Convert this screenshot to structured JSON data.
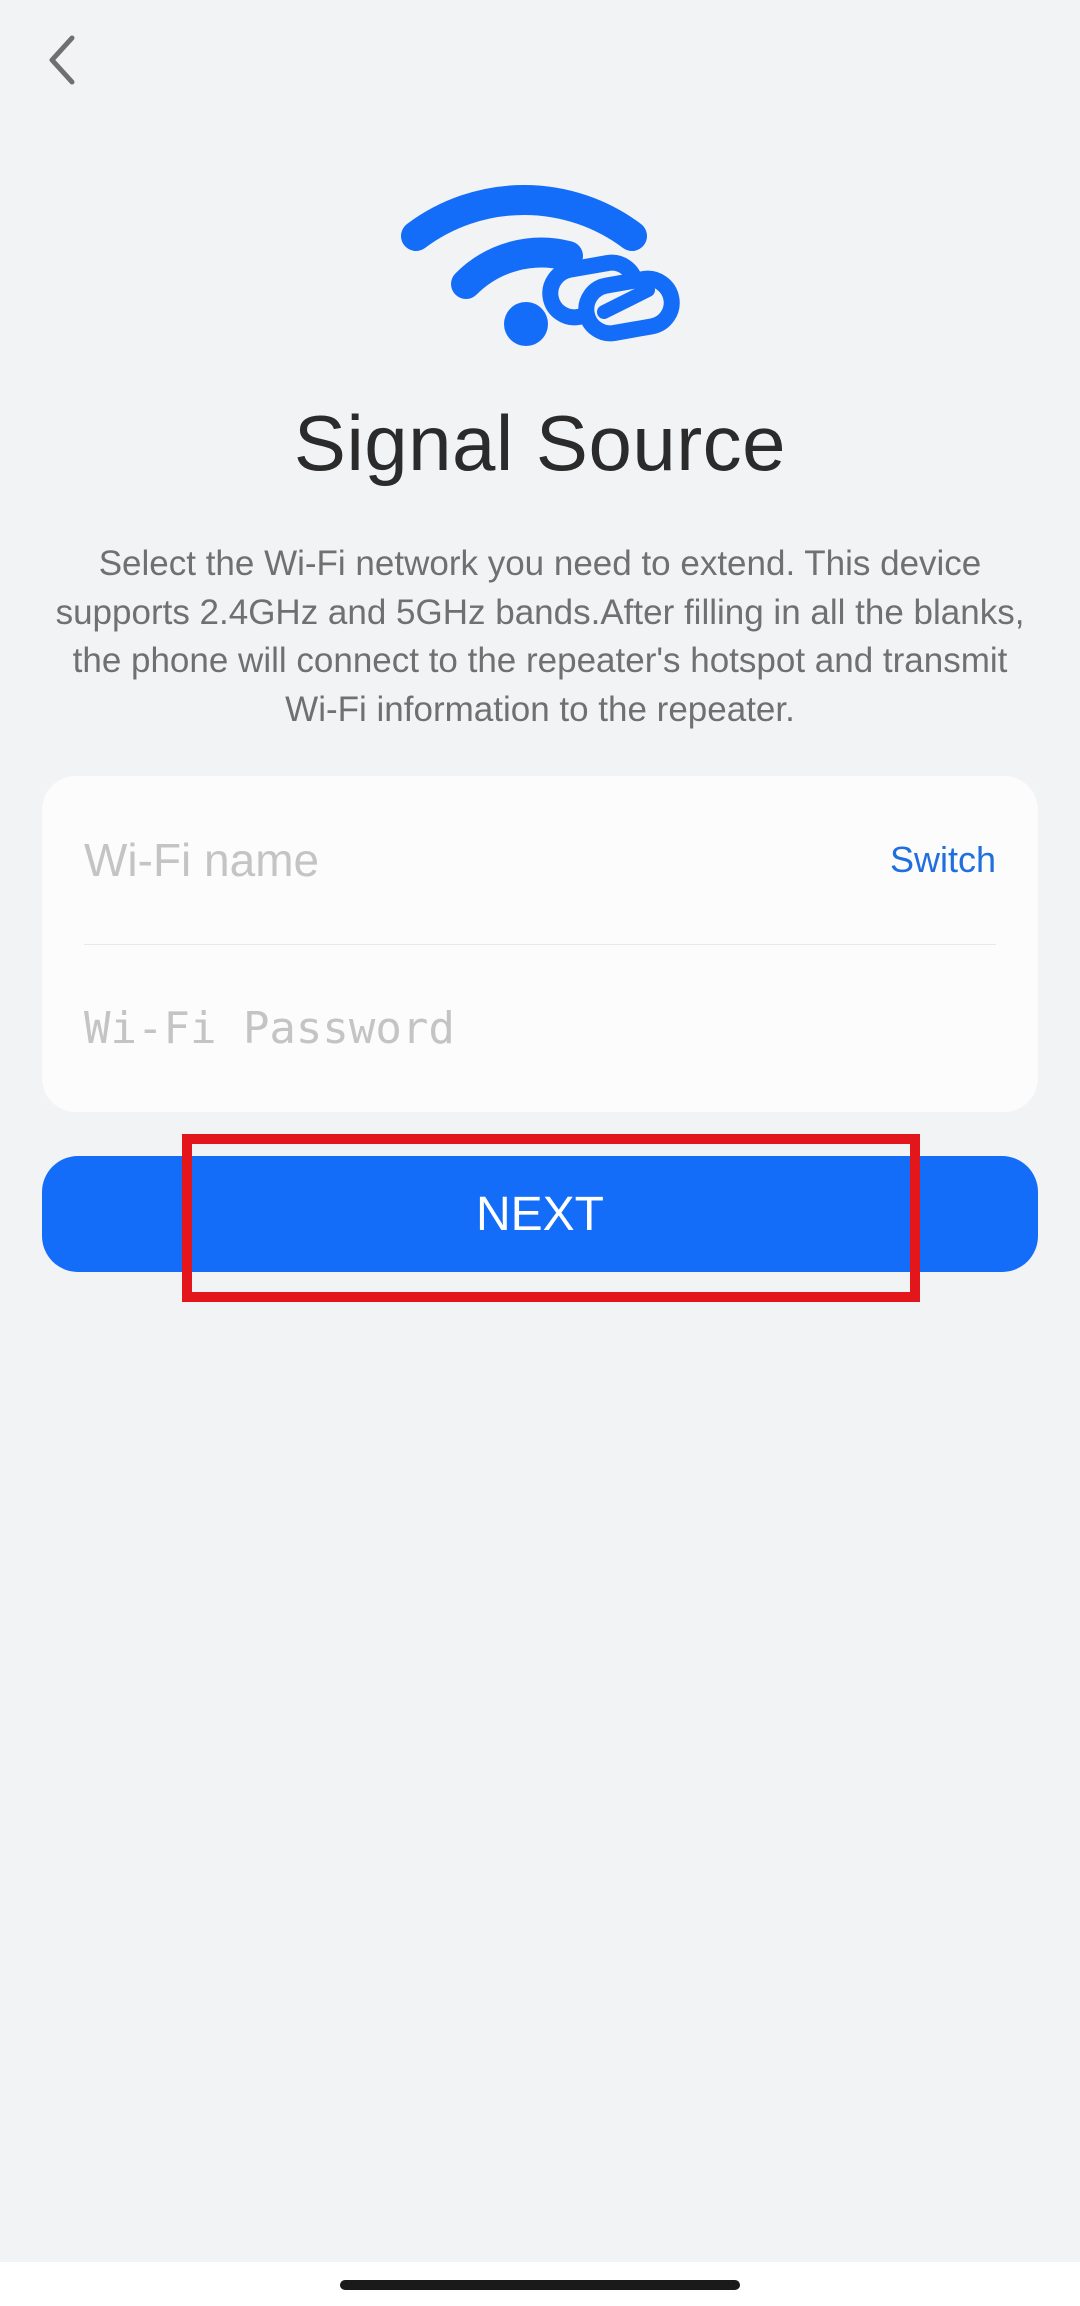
{
  "header": {
    "back_icon": "chevron-left-icon"
  },
  "hero": {
    "icon": "wifi-link-icon",
    "icon_color": "#136df8"
  },
  "title": "Signal Source",
  "description": "Select the Wi-Fi network you need to extend. This device supports 2.4GHz and 5GHz bands.After filling in all the blanks, the phone will connect to the repeater's hotspot and transmit Wi-Fi information to the repeater.",
  "form": {
    "wifi_name": {
      "placeholder": "Wi-Fi name",
      "value": "",
      "switch_label": "Switch"
    },
    "wifi_password": {
      "placeholder": "Wi-Fi Password",
      "value": ""
    }
  },
  "next_button": {
    "label": "NEXT",
    "color": "#136df8"
  },
  "colors": {
    "accent": "#136df8",
    "link": "#1f6fde",
    "highlight": "#e3171b",
    "background": "#f2f3f5"
  }
}
